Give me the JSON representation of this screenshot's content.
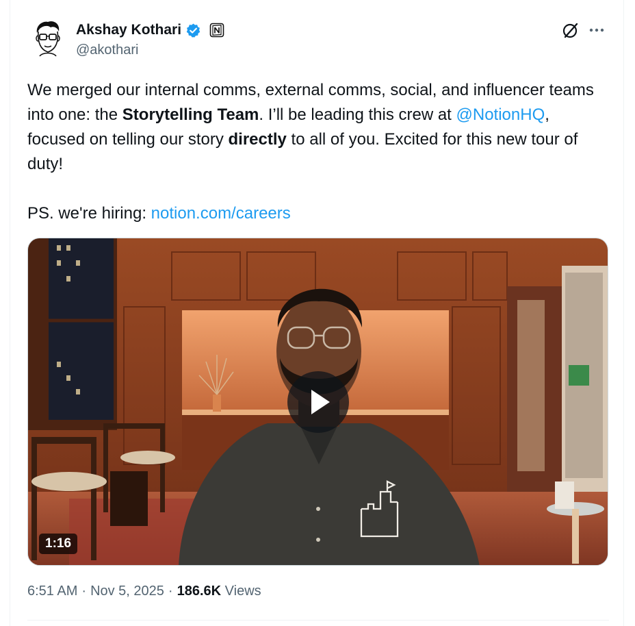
{
  "author": {
    "display_name": "Akshay Kothari",
    "handle": "@akothari",
    "verified_icon": "verified-badge-icon",
    "affiliation_icon": "notion-logo-icon",
    "avatar": "avatar-illustration"
  },
  "actions": {
    "grok_icon": "grok-icon",
    "more_icon": "more-icon"
  },
  "text": {
    "line1_part1": "We merged our internal comms, external comms, social, and influencer teams into one: the ",
    "line1_bold": "Storytelling Team",
    "line1_part2": ". I’ll be leading this crew at ",
    "mention": "@NotionHQ",
    "line2_part1": ", focused on telling our story ",
    "line2_bold": "directly",
    "line2_part2": " to all of you. Excited for this new tour of duty!",
    "ps_text": "PS. we're hiring: ",
    "ps_link": "notion.com/careers"
  },
  "media": {
    "type": "video",
    "duration": "1:16",
    "play_icon": "play-icon"
  },
  "meta": {
    "time": "6:51 AM",
    "sep1": "·",
    "date": "Nov 5, 2025",
    "sep2": "·",
    "views_count": "186.6K",
    "views_label": "Views"
  },
  "colors": {
    "link": "#1d9bf0",
    "verified": "#1d9bf0",
    "secondary_text": "#536471",
    "primary_text": "#0f1419"
  }
}
